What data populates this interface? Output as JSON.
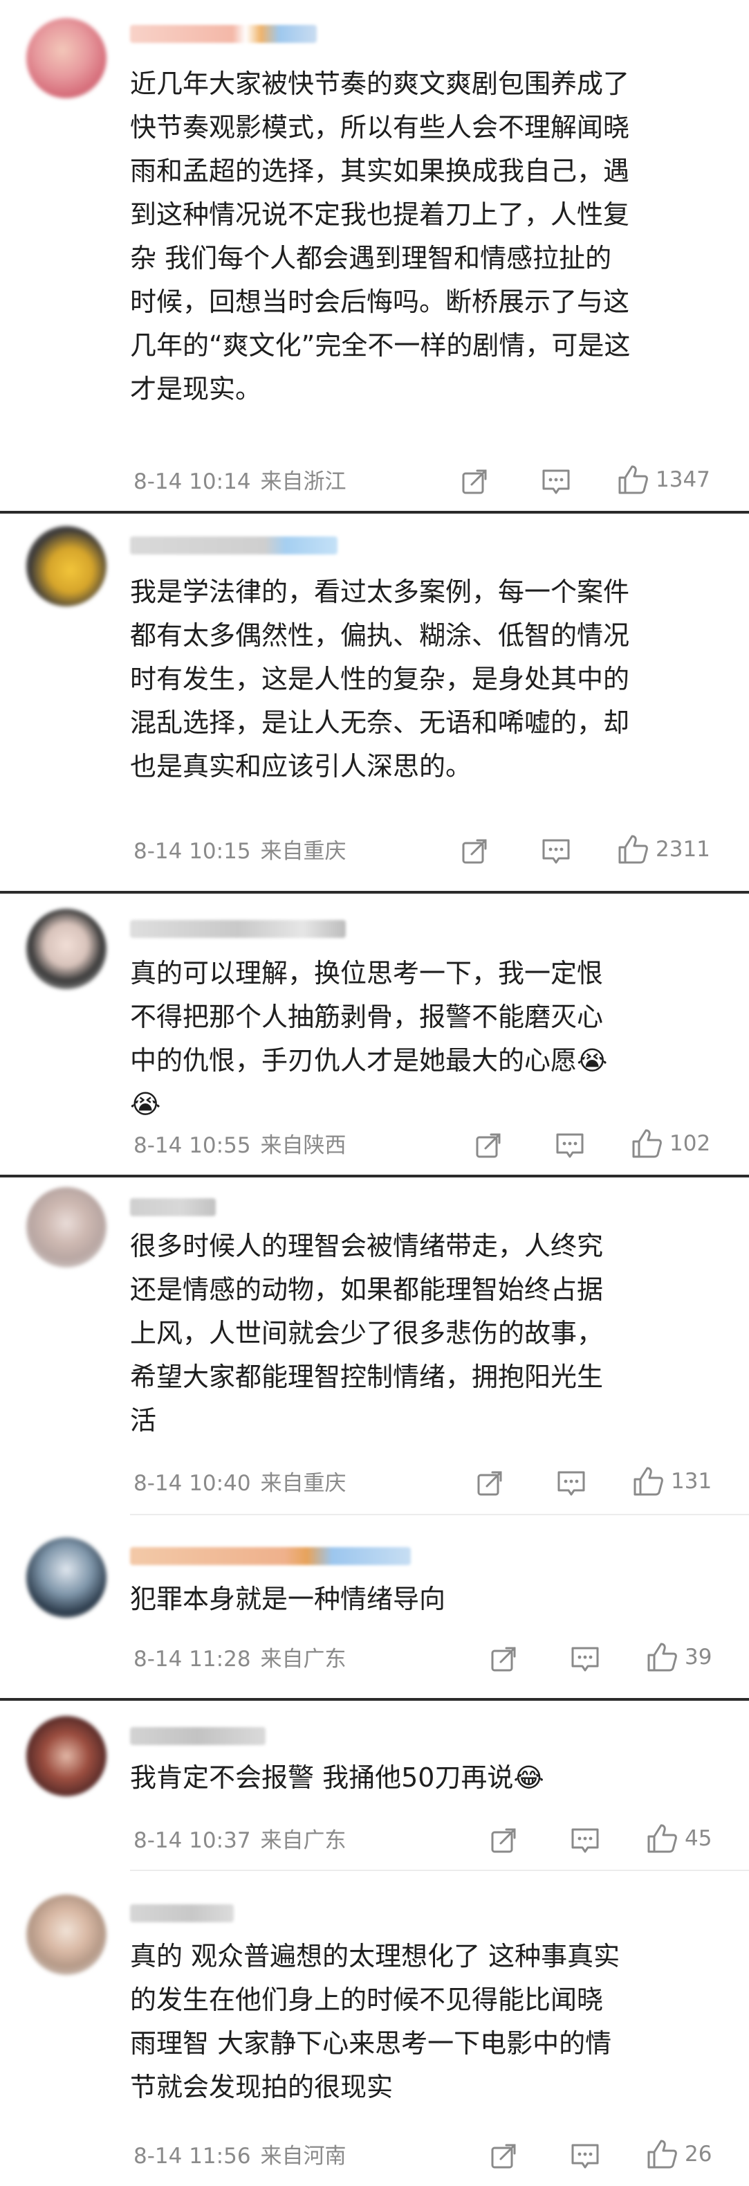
{
  "comments": [
    {
      "text": "近几年大家被快节奏的爽文爽剧包围养成了\n快节奏观影模式，所以有些人会不理解闻晓\n雨和孟超的选择，其实如果换成我自己，遇\n到这种情况说不定我也提着刀上了，人性复\n杂 我们每个人都会遇到理智和情感拉扯的\n时候，回想当时会后悔吗。断桥展示了与这\n几年的“爽文化”完全不一样的剧情，可是这\n才是现实。",
      "time": "8-14 10:14",
      "location": "来自浙江",
      "likes": "1347"
    },
    {
      "text": "我是学法律的，看过太多案例，每一个案件\n都有太多偶然性，偏执、糊涂、低智的情况\n时有发生，这是人性的复杂，是身处其中的\n混乱选择，是让人无奈、无语和唏嘘的，却\n也是真实和应该引人深思的。",
      "time": "8-14 10:15",
      "location": "来自重庆",
      "likes": "2311"
    },
    {
      "text": "真的可以理解，换位思考一下，我一定恨\n不得把那个人抽筋剥骨，报警不能磨灭心\n中的仇恨，手刃仇人才是她最大的心愿😭\n😭",
      "time": "8-14 10:55",
      "location": "来自陕西",
      "likes": "102"
    },
    {
      "text": "很多时候人的理智会被情绪带走，人终究\n还是情感的动物，如果都能理智始终占据\n上风，人世间就会少了很多悲伤的故事，\n希望大家都能理智控制情绪，拥抱阳光生\n活",
      "time": "8-14 10:40",
      "location": "来自重庆",
      "likes": "131",
      "reply": {
        "text": "犯罪本身就是一种情绪导向",
        "time": "8-14 11:28",
        "location": "来自广东",
        "likes": "39"
      }
    },
    {
      "text": "我肯定不会报警 我捅他50刀再说😂",
      "time": "8-14 10:37",
      "location": "来自广东",
      "likes": "45",
      "reply": {
        "text": "真的 观众普遍想的太理想化了 这种事真实\n的发生在他们身上的时候不见得能比闻晓\n雨理智 大家静下心来思考一下电影中的情\n节就会发现拍的很现实",
        "time": "8-14 11:56",
        "location": "来自河南",
        "likes": "26"
      }
    }
  ],
  "icons": {
    "share": "share-icon",
    "reply": "comment-icon",
    "like": "thumbs-up-icon"
  },
  "colors": {
    "text": "#1e1e1e",
    "meta": "#8a8a8a",
    "separator": "#2b2b2b"
  }
}
